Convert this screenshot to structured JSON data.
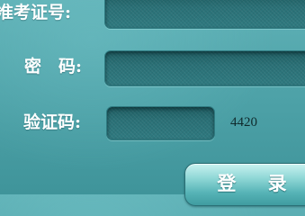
{
  "form": {
    "ticket_label": "准考证号:",
    "password_label": "密　码:",
    "captcha_label": "验证码:",
    "ticket_value": "",
    "password_value": "",
    "captcha_value": "",
    "captcha_code": "4420",
    "login_label": "登 录"
  },
  "colors": {
    "background": "#4fa3a9",
    "field": "#2a7076",
    "label": "#ffffff"
  }
}
